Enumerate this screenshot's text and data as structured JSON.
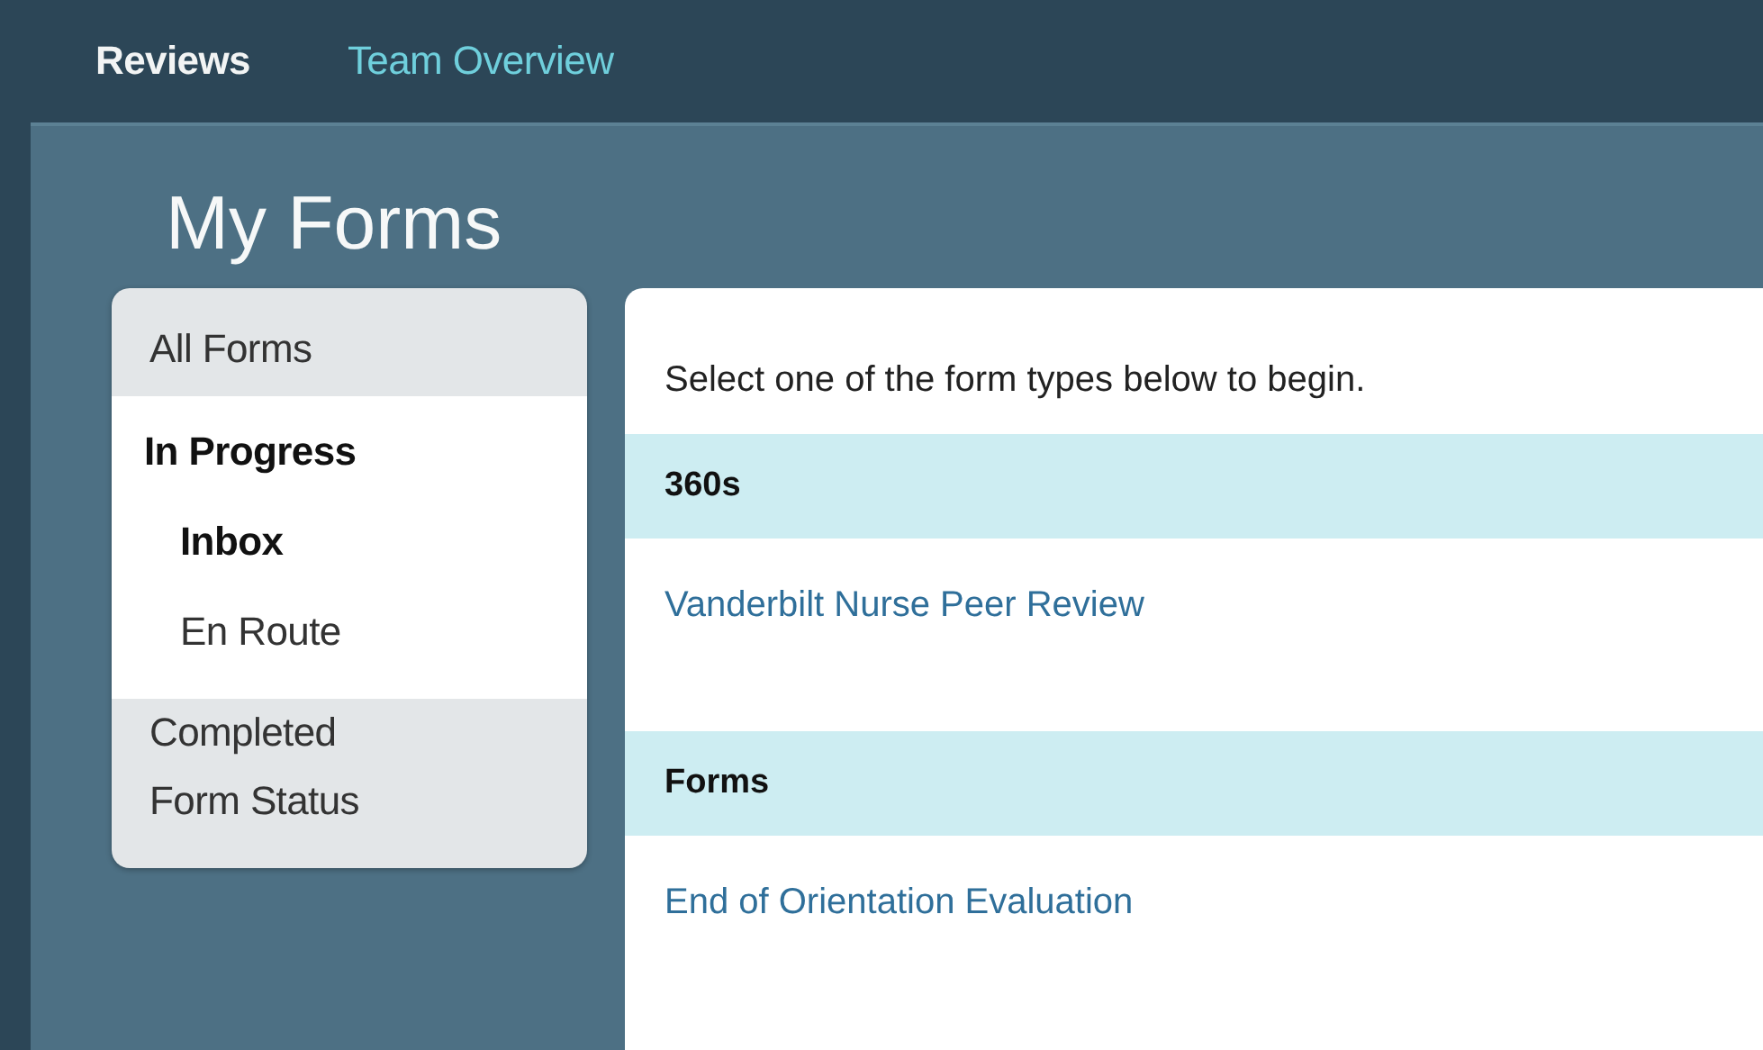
{
  "nav": {
    "tabs": [
      {
        "label": "Reviews",
        "selected": true
      },
      {
        "label": "Team Overview",
        "selected": false
      }
    ]
  },
  "page": {
    "title": "My Forms"
  },
  "sidebar": {
    "items": [
      {
        "label": "All Forms",
        "selected": false
      },
      {
        "label": "In Progress",
        "selected": true,
        "expanded": true,
        "children": [
          {
            "label": "Inbox",
            "selected": true
          },
          {
            "label": "En Route",
            "selected": false
          }
        ]
      },
      {
        "label": "Completed",
        "selected": false
      },
      {
        "label": "Form Status",
        "selected": false
      }
    ]
  },
  "content": {
    "intro": "Select one of the form types below to begin.",
    "sections": [
      {
        "heading": "360s",
        "links": [
          "Vanderbilt Nurse Peer Review"
        ]
      },
      {
        "heading": "Forms",
        "links": [
          "End of Orientation Evaluation"
        ]
      }
    ]
  }
}
